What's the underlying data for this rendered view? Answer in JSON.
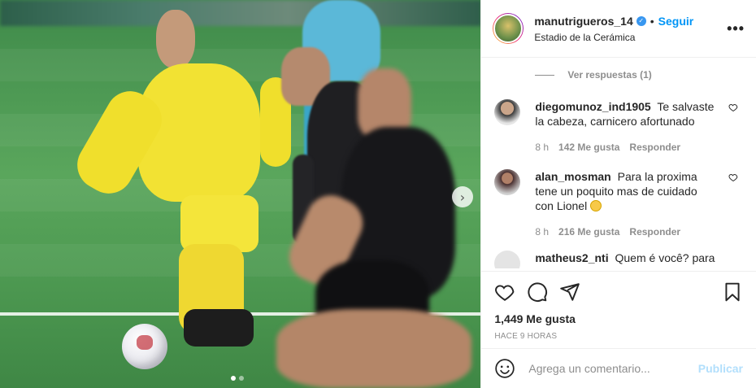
{
  "header": {
    "username": "manutrigueros_14",
    "separator": "•",
    "follow_label": "Seguir",
    "location": "Estadio de la Cerámica",
    "more_label": "•••"
  },
  "comments": {
    "view_replies": "Ver respuestas (1)",
    "items": [
      {
        "user": "diegomunoz_ind1905",
        "text": "Te salvaste la cabeza, carnicero afortunado",
        "time": "8 h",
        "likes": "142 Me gusta",
        "reply": "Responder",
        "avatar_color": "#d9d9d9"
      },
      {
        "user": "alan_mosman",
        "text": "Para la proxima tene un poquito mas de cuidado con Lionel",
        "time": "8 h",
        "likes": "216 Me gusta",
        "reply": "Responder",
        "avatar_color": "#c7c7c7"
      },
      {
        "user": "matheus2_nti",
        "text": "Quem é você? para",
        "avatar_color": "#cfcfcf"
      }
    ]
  },
  "actions": {
    "likes_count": "1,449 Me gusta",
    "time_ago": "HACE 9 HORAS"
  },
  "add_comment": {
    "placeholder": "Agrega un comentario...",
    "publish_label": "Publicar"
  },
  "media": {
    "next_arrow": "›",
    "slides": 2,
    "active_slide": 1
  },
  "colors": {
    "accent": "#0095f6",
    "publish_disabled": "#b2dffc",
    "pitch": "#4e9a54"
  }
}
